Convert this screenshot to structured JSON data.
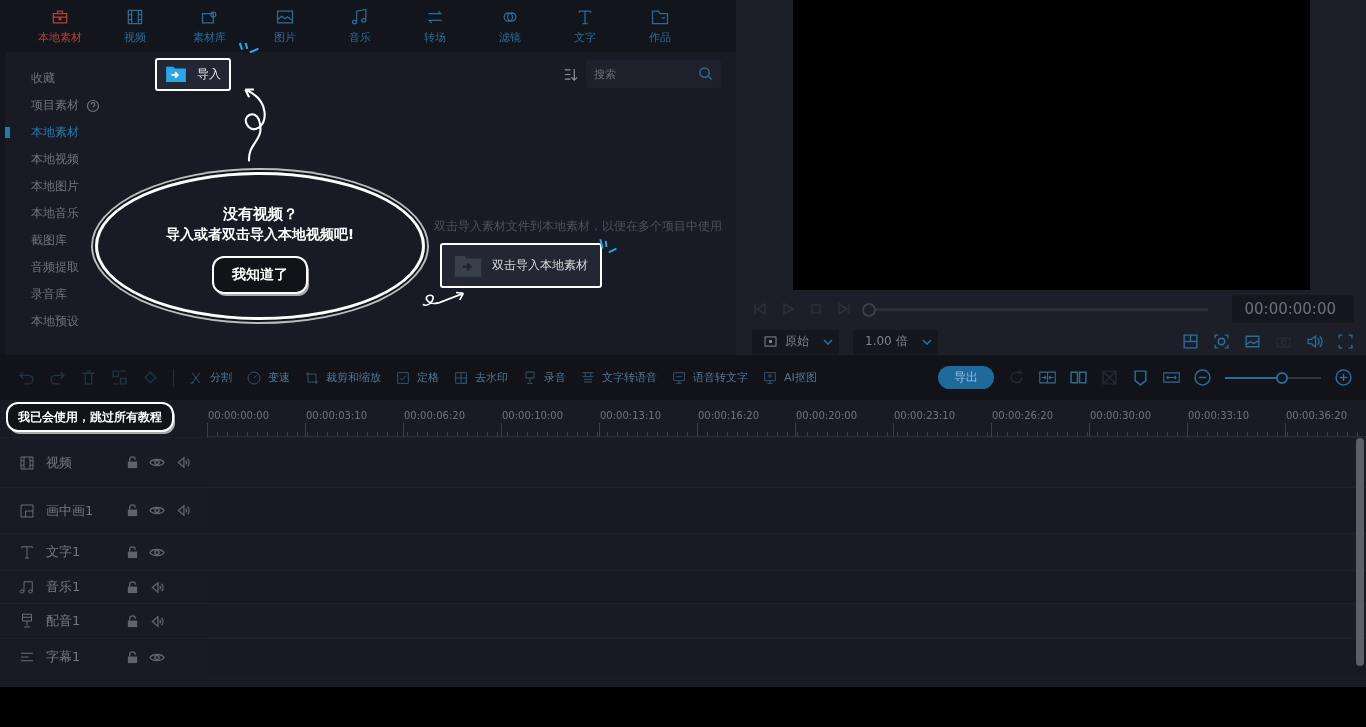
{
  "media_tabs": [
    {
      "kind": "local",
      "label": "本地素材",
      "selected": true
    },
    {
      "kind": "video",
      "label": "视频",
      "selected": false
    },
    {
      "kind": "library",
      "label": "素材库",
      "selected": false
    },
    {
      "kind": "image",
      "label": "图片",
      "selected": false
    },
    {
      "kind": "music",
      "label": "音乐",
      "selected": false
    },
    {
      "kind": "transition",
      "label": "转场",
      "selected": false
    },
    {
      "kind": "filter",
      "label": "滤镜",
      "selected": false
    },
    {
      "kind": "text",
      "label": "文字",
      "selected": false
    },
    {
      "kind": "works",
      "label": "作品",
      "selected": false
    }
  ],
  "library": {
    "sidebar": [
      {
        "label": "收藏",
        "selected": false,
        "help": false
      },
      {
        "label": "项目素材",
        "selected": false,
        "help": true
      },
      {
        "label": "本地素材",
        "selected": true,
        "help": false
      },
      {
        "label": "本地视频",
        "selected": false,
        "help": false
      },
      {
        "label": "本地图片",
        "selected": false,
        "help": false
      },
      {
        "label": "本地音乐",
        "selected": false,
        "help": false
      },
      {
        "label": "截图库",
        "selected": false,
        "help": false
      },
      {
        "label": "音频提取",
        "selected": false,
        "help": false
      },
      {
        "label": "录音库",
        "selected": false,
        "help": false
      },
      {
        "label": "本地预设",
        "selected": false,
        "help": false
      }
    ],
    "import_button": "导入",
    "search": {
      "placeholder": "搜索"
    },
    "empty_hint": "双击导入素材文件到本地素材，以便在多个项目中使用",
    "import_local_button": "双击导入本地素材"
  },
  "preview": {
    "scrubber": {
      "level": 0
    },
    "timecode": "00:00:00:00",
    "aspect": "原始",
    "speed": "1.00 倍"
  },
  "edit_toolbar": {
    "tools": [
      {
        "kind": "split",
        "label": "分割"
      },
      {
        "kind": "speed",
        "label": "变速"
      },
      {
        "kind": "crop",
        "label": "裁剪和缩放"
      },
      {
        "kind": "freeze",
        "label": "定格"
      },
      {
        "kind": "watermark",
        "label": "去水印"
      },
      {
        "kind": "record",
        "label": "录音"
      },
      {
        "kind": "tts",
        "label": "文字转语音"
      },
      {
        "kind": "stt",
        "label": "语音转文字"
      },
      {
        "kind": "cutout",
        "label": "AI抠图"
      }
    ],
    "export_button": "导出",
    "zoom": {
      "level": 0.59
    }
  },
  "ruler": [
    "00:00:00:00",
    "00:00:03:10",
    "00:00:06:20",
    "00:00:10:00",
    "00:00:13:10",
    "00:00:16:20",
    "00:00:20:00",
    "00:00:23:10",
    "00:00:26:20",
    "00:00:30:00",
    "00:00:33:10",
    "00:00:36:20"
  ],
  "tracks": [
    {
      "kind": "video",
      "label": "视频",
      "eye": true,
      "audio": true
    },
    {
      "kind": "pip",
      "label": "画中画1",
      "eye": true,
      "audio": true
    },
    {
      "kind": "text",
      "label": "文字1",
      "eye": true,
      "audio": false
    },
    {
      "kind": "music",
      "label": "音乐1",
      "eye": false,
      "audio": true
    },
    {
      "kind": "voice",
      "label": "配音1",
      "eye": false,
      "audio": true
    },
    {
      "kind": "subtitle",
      "label": "字幕1",
      "eye": true,
      "audio": false
    }
  ],
  "tutorial": {
    "question": "没有视频？",
    "prompt": "导入或者双击导入本地视频吧!",
    "got_it": "我知道了",
    "skip": "我已会使用，跳过所有教程"
  }
}
